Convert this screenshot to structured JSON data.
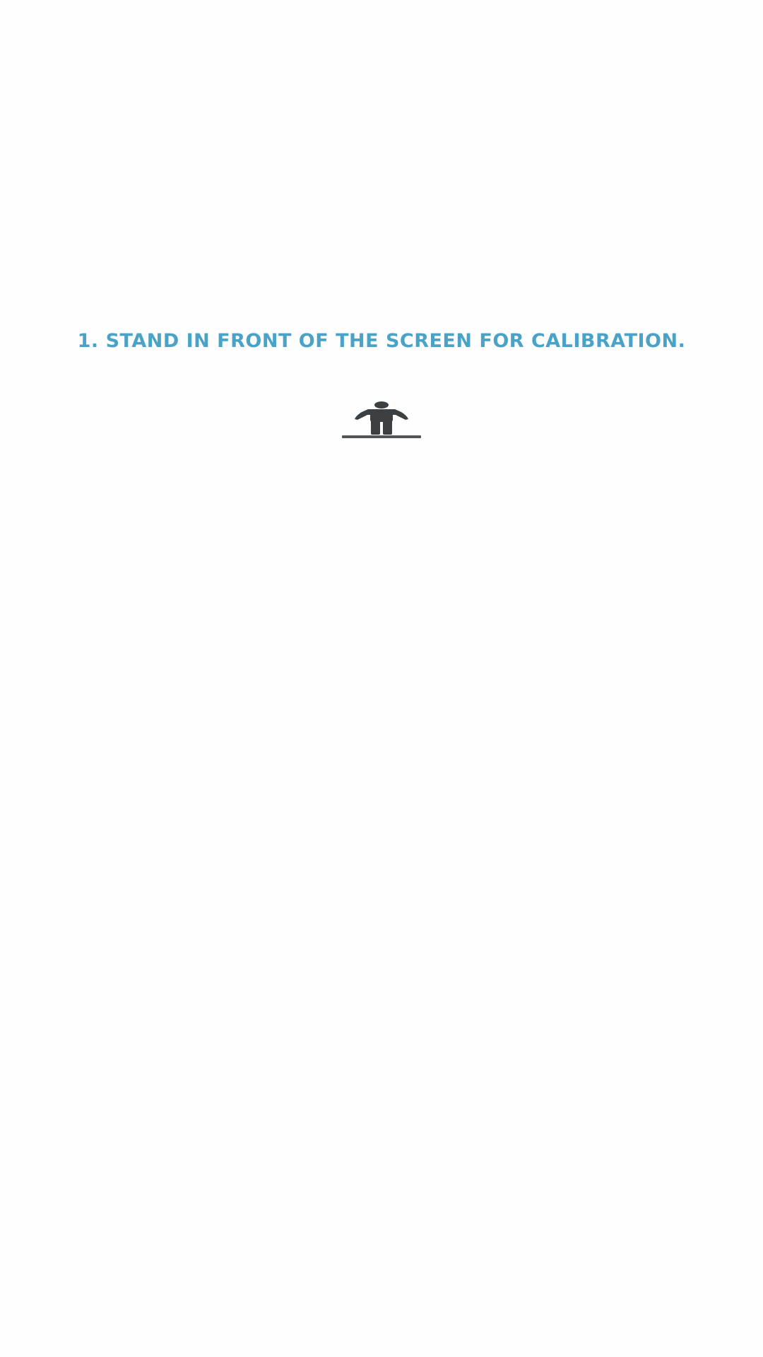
{
  "calibration": {
    "instruction": "1. Stand in front of the screen for calibration.",
    "icon": "standing-person-icon"
  },
  "colors": {
    "background": "#fefefe",
    "instruction_text": "#4aa3c7",
    "icon_fill": "#3c4042",
    "floor_line": "#515557"
  }
}
